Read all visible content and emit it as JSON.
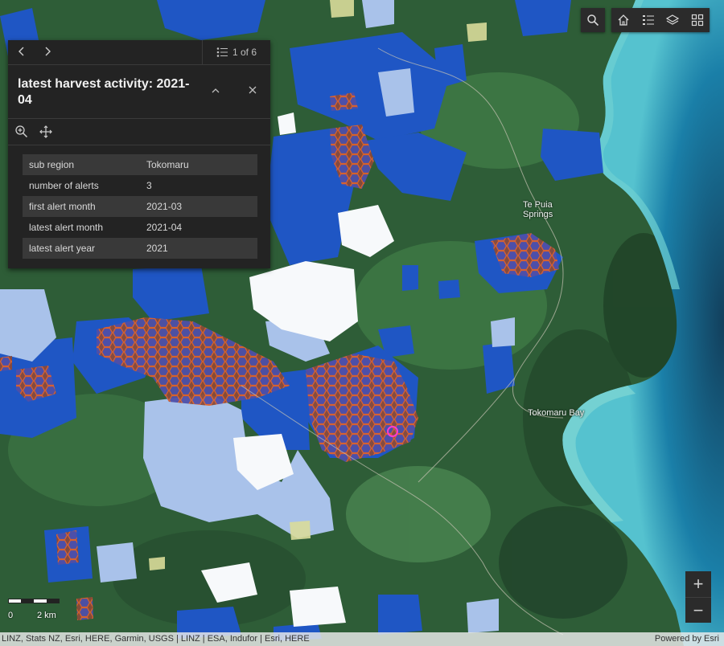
{
  "map": {
    "place_labels": [
      "Te Puia\nSprings",
      "Tokomaru Bay"
    ],
    "scale": {
      "zero": "0",
      "distance": "2 km"
    },
    "attribution": "LINZ, Stats NZ, Esri, HERE, Garmin, USGS | LINZ | ESA, Indufor | Esri, HERE",
    "powered_by": "Powered by Esri",
    "colors": {
      "ocean": "#1a7fa8",
      "forest": "#2b5a36",
      "harvest_blue": "#1f56c4",
      "harvest_light": "#aac0e6",
      "alert_hex": "#d9642a"
    }
  },
  "popup": {
    "pager_text": "1 of 6",
    "title": "latest harvest activity: 2021-04",
    "fields": [
      {
        "key": "sub region",
        "value": "Tokomaru"
      },
      {
        "key": "number of alerts",
        "value": "3"
      },
      {
        "key": "first alert month",
        "value": "2021-03"
      },
      {
        "key": "latest alert month",
        "value": "2021-04"
      },
      {
        "key": "latest alert year",
        "value": "2021"
      }
    ]
  },
  "toolbar": {
    "icons": [
      "search-icon",
      "home-icon",
      "legend-icon",
      "layers-icon",
      "basemap-gallery-icon"
    ]
  },
  "zoom": {
    "in_label": "+",
    "out_label": "−"
  }
}
